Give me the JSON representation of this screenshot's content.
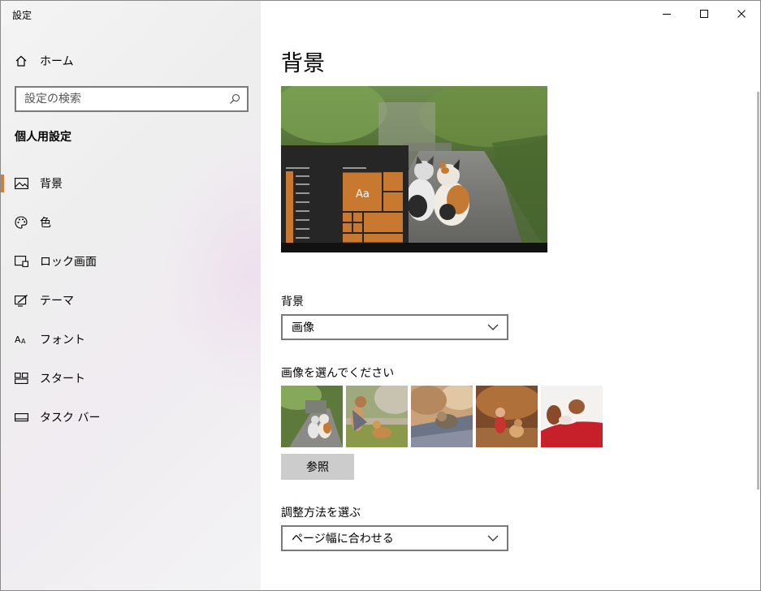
{
  "window": {
    "title": "設定"
  },
  "sidebar": {
    "home_label": "ホーム",
    "search_placeholder": "設定の検索",
    "section_title": "個人用設定",
    "items": [
      {
        "label": "背景",
        "icon": "picture-icon",
        "active": true
      },
      {
        "label": "色",
        "icon": "palette-icon",
        "active": false
      },
      {
        "label": "ロック画面",
        "icon": "lock-screen-icon",
        "active": false
      },
      {
        "label": "テーマ",
        "icon": "theme-icon",
        "active": false
      },
      {
        "label": "フォント",
        "icon": "font-icon",
        "active": false
      },
      {
        "label": "スタート",
        "icon": "start-icon",
        "active": false
      },
      {
        "label": "タスク バー",
        "icon": "taskbar-icon",
        "active": false
      }
    ]
  },
  "main": {
    "title": "背景",
    "preview_tile_text": "Aa",
    "background_label": "背景",
    "background_value": "画像",
    "choose_image_label": "画像を選んでください",
    "browse_label": "参照",
    "fit_label": "調整方法を選ぶ",
    "fit_value": "ページ幅に合わせる"
  },
  "colors": {
    "accent": "#d47d3a",
    "sidebar_bg": "#f2f2f2",
    "button_bg": "#cccccc"
  }
}
